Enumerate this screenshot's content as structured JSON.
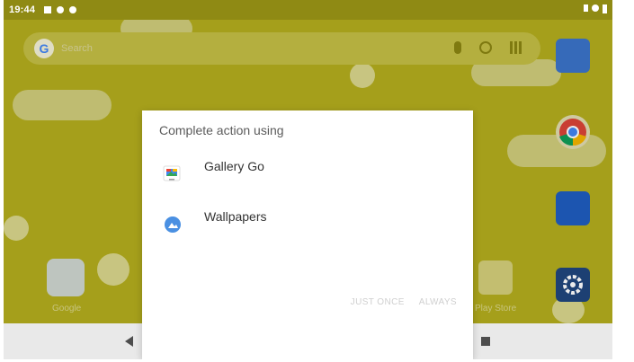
{
  "status_bar": {
    "time": "19:44"
  },
  "search": {
    "placeholder": "Search",
    "logo": "G"
  },
  "dock": {
    "google_label": "Google",
    "play_label": "Play Store"
  },
  "dialog": {
    "title": "Complete action using",
    "options": [
      {
        "label": "Gallery Go",
        "icon": "gallery-go-icon"
      },
      {
        "label": "Wallpapers",
        "icon": "wallpapers-icon"
      }
    ],
    "just_once": "JUST ONCE",
    "always": "ALWAYS"
  },
  "colors": {
    "wallpaper": "#b3ad1e",
    "dialog_bg": "#ffffff",
    "nav_bar": "#e9e9e9"
  }
}
